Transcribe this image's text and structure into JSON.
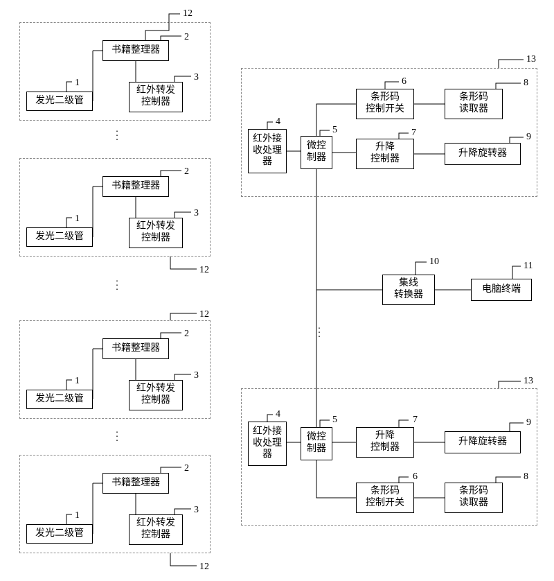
{
  "labels": {
    "n1": "1",
    "n2": "2",
    "n3": "3",
    "n4": "4",
    "n5": "5",
    "n6": "6",
    "n7": "7",
    "n8": "8",
    "n9": "9",
    "n10": "10",
    "n11": "11",
    "n12": "12",
    "n13": "13"
  },
  "blocks": {
    "led": "发光二级管",
    "book_sorter": "书籍整理器",
    "ir_forward_ctrl": "红外转发\n控制器",
    "ir_recv_proc": "红外接\n收处理\n器",
    "microcontroller": "微控\n制器",
    "barcode_switch": "条形码\n控制开关",
    "lift_ctrl": "升降\n控制器",
    "barcode_reader": "条形码\n读取器",
    "lift_rotator": "升降旋转器",
    "hub_converter": "集线\n转换器",
    "pc_terminal": "电脑终端"
  },
  "chart_data": {
    "type": "diagram",
    "title": "",
    "legend_numbers": {
      "1": "发光二级管",
      "2": "书籍整理器",
      "3": "红外转发控制器",
      "4": "红外接收处理器",
      "5": "微控制器",
      "6": "条形码控制开关",
      "7": "升降控制器",
      "8": "条形码读取器",
      "9": "升降旋转器",
      "10": "集线转换器",
      "11": "电脑终端",
      "12": "书籍整理器 (dashed group containing 1,2,3)",
      "13": "(dashed group containing 4,5,6,7,8,9)"
    },
    "left_groups": {
      "count_shown": 4,
      "repetition": "vertical ellipses indicate many repeated group-12 units",
      "internal_edges_per_group": [
        {
          "from": 1,
          "to": 2
        },
        {
          "from": 2,
          "to": 3
        }
      ]
    },
    "right_groups": {
      "count_shown": 2,
      "repetition": "vertical ellipses between the two shown group-13 units indicate repetition",
      "internal_edges_per_group": [
        {
          "from": 4,
          "to": 5
        },
        {
          "from": 5,
          "to": 6
        },
        {
          "from": 5,
          "to": 7
        },
        {
          "from": 6,
          "to": 8
        },
        {
          "from": 7,
          "to": 9
        }
      ]
    },
    "global_edges": [
      {
        "from": "each group-13 unit (microcontroller 5)",
        "to": 10,
        "via": "shared vertical bus"
      },
      {
        "from": 10,
        "to": 11
      }
    ],
    "ir_link": {
      "description": "Each group-12 unit's 红外转发控制器 (3) communicates wirelessly to a group-13 unit's 红外接收处理器 (4). Drawn only implicitly (no solid line between left and right columns)."
    }
  }
}
